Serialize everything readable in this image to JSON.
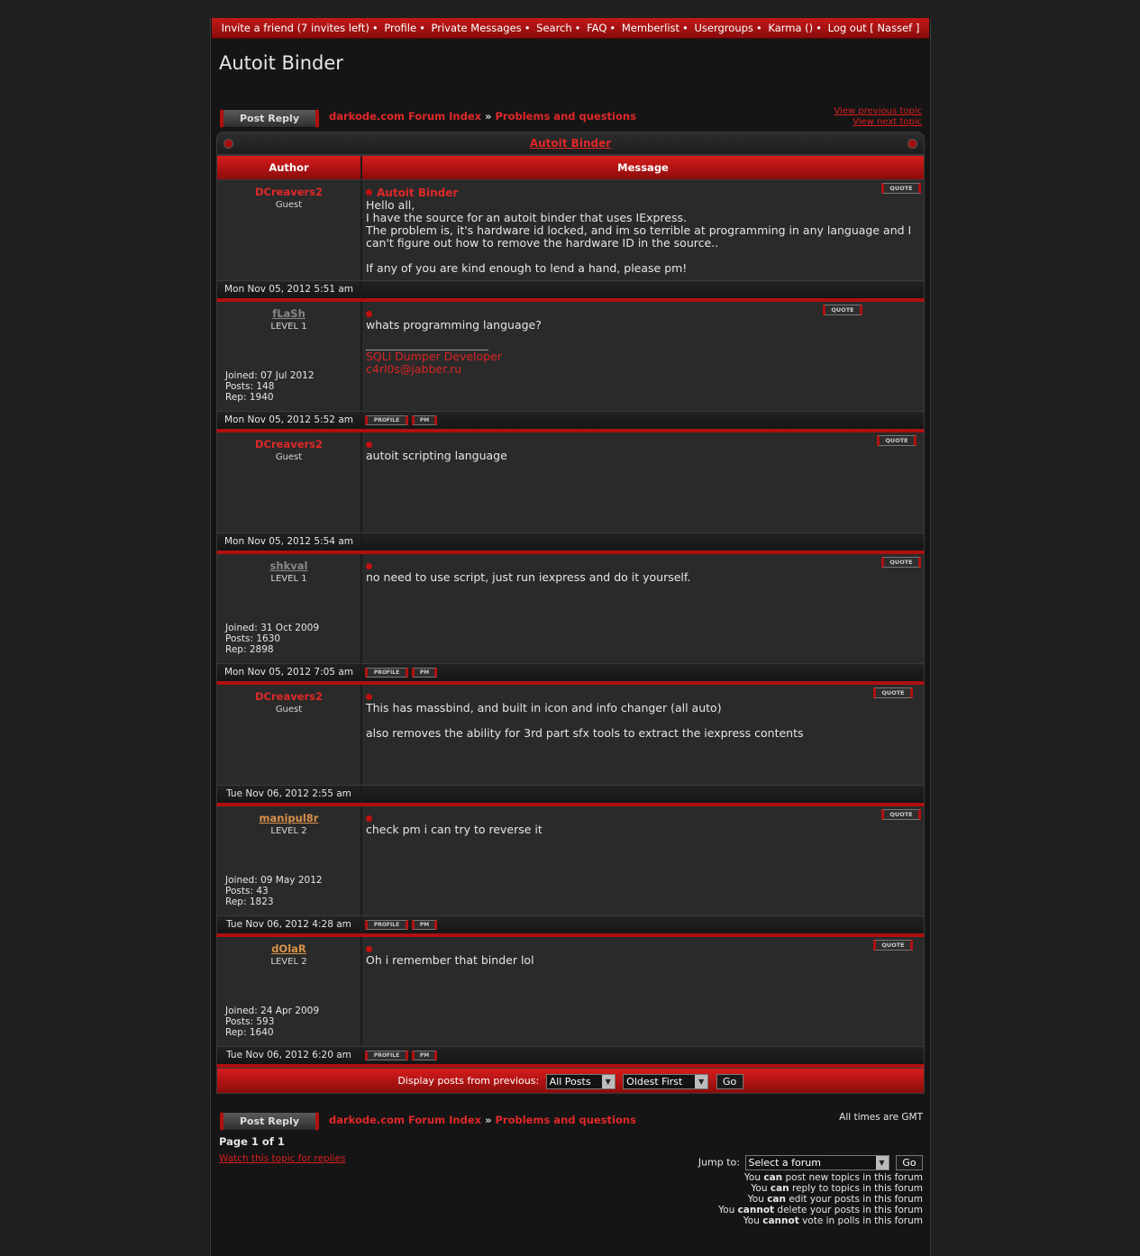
{
  "nav": {
    "items": [
      "Invite a friend (7 invites left)",
      "Profile",
      "Private Messages",
      "Search",
      "FAQ",
      "Memberlist",
      "Usergroups",
      "Karma ()",
      "Log out [ Nassef ]"
    ],
    "separator": "•"
  },
  "page_title": "Autoit Binder",
  "reply_label": "Post Reply",
  "breadcrumb": {
    "index": "darkode.com Forum Index",
    "sep": "»",
    "forum": "Problems and questions"
  },
  "topic_nav": {
    "prev": "View previous topic",
    "next": "View next topic"
  },
  "table": {
    "title": "Autoit Binder",
    "col_author": "Author",
    "col_message": "Message"
  },
  "buttons": {
    "quote": "QUOTE",
    "profile": "PROFILE",
    "pm": "PM"
  },
  "labels": {
    "joined": "Joined:",
    "posts": "Posts:",
    "rep": "Rep:"
  },
  "posts": [
    {
      "author": "DCreavers2",
      "rank": "Guest",
      "subject": "Autoit Binder",
      "lines": [
        "Hello all,",
        "I have the source for an autoit binder that uses IExpress.",
        "The problem is, it's hardware id locked, and im so terrible at programming in any language and I can't figure out how to remove the hardware ID in the source..",
        "",
        "If any of you are kind enough to lend a hand, please pm!"
      ],
      "date": "Mon Nov 05, 2012 5:51 am"
    },
    {
      "author": "fLaSh",
      "rank": "LEVEL 1",
      "joined": "07 Jul 2012",
      "posts": "148",
      "rep": "1940",
      "lines": [
        "whats programming language?"
      ],
      "sig": [
        "SQLi Dumper Developer",
        "c4rl0s@jabber.ru"
      ],
      "date": "Mon Nov 05, 2012 5:52 am"
    },
    {
      "author": "DCreavers2",
      "rank": "Guest",
      "lines": [
        "autoit scripting language"
      ],
      "date": "Mon Nov 05, 2012 5:54 am"
    },
    {
      "author": "shkval",
      "rank": "LEVEL 1",
      "joined": "31 Oct 2009",
      "posts": "1630",
      "rep": "2898",
      "lines": [
        "no need to use script, just run iexpress and do it yourself."
      ],
      "date": "Mon Nov 05, 2012 7:05 am"
    },
    {
      "author": "DCreavers2",
      "rank": "Guest",
      "lines": [
        "This has massbind, and built in icon and info changer (all auto)",
        "",
        "also removes the ability for 3rd part sfx tools to extract the iexpress contents"
      ],
      "date": "Tue Nov 06, 2012 2:55 am"
    },
    {
      "author": "manipul8r",
      "rank": "LEVEL 2",
      "joined": "09 May 2012",
      "posts": "43",
      "rep": "1823",
      "lines": [
        "check pm i can try to reverse it"
      ],
      "date": "Tue Nov 06, 2012 4:28 am"
    },
    {
      "author": "dOlaR",
      "rank": "LEVEL 2",
      "joined": "24 Apr 2009",
      "posts": "593",
      "rep": "1640",
      "lines": [
        "Oh i remember that binder lol"
      ],
      "date": "Tue Nov 06, 2012 6:20 am"
    }
  ],
  "display": {
    "label": "Display posts from previous:",
    "posts_value": "All Posts",
    "order_value": "Oldest First",
    "go": "Go"
  },
  "timezone": "All times are GMT",
  "page_info": "Page 1 of 1",
  "watch": "Watch this topic for replies",
  "jump": {
    "label": "Jump to:",
    "value": "Select a forum",
    "go": "Go"
  },
  "permissions": [
    {
      "pre": "You",
      "b": "can",
      "post": "post new topics in this forum"
    },
    {
      "pre": "You",
      "b": "can",
      "post": "reply to topics in this forum"
    },
    {
      "pre": "You",
      "b": "can",
      "post": "edit your posts in this forum"
    },
    {
      "pre": "You",
      "b": "cannot",
      "post": "delete your posts in this forum"
    },
    {
      "pre": "You",
      "b": "cannot",
      "post": "vote in polls in this forum"
    }
  ]
}
